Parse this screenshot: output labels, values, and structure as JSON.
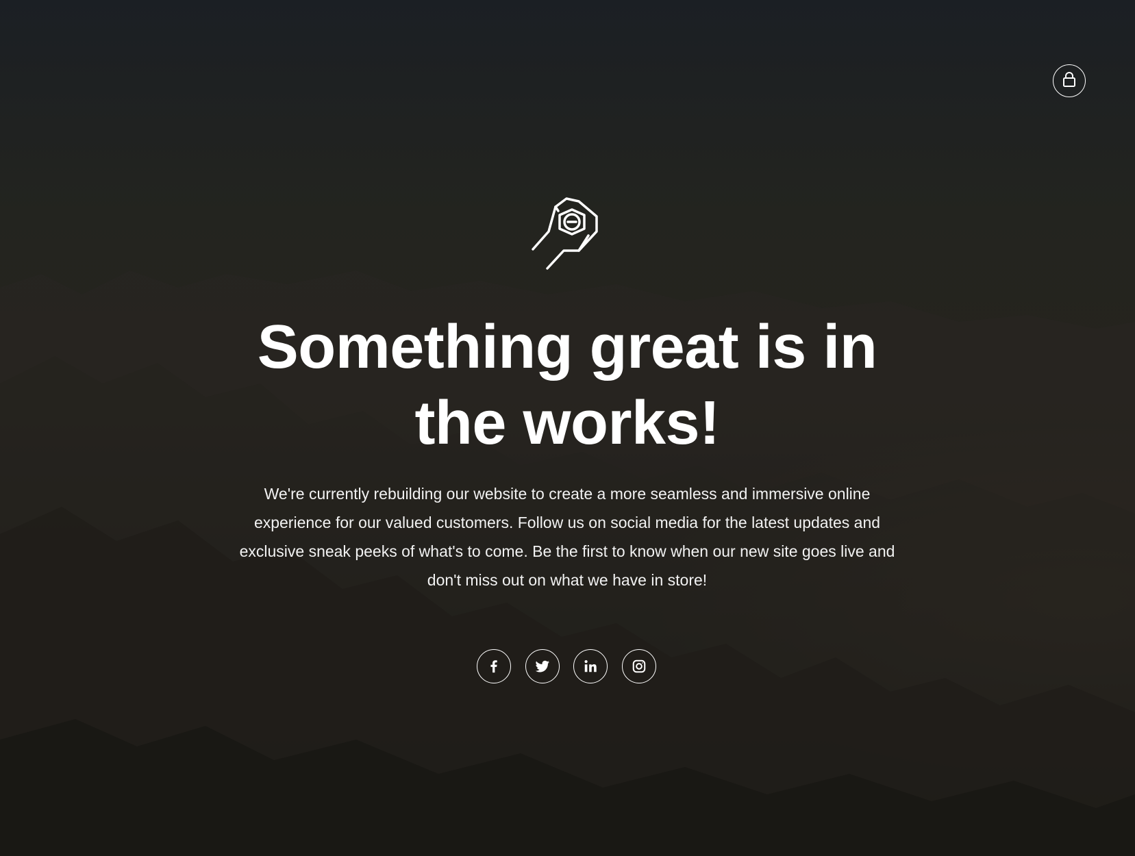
{
  "header": {
    "lock_icon": "lock-icon"
  },
  "logo": {
    "icon": "wrench-hand-icon"
  },
  "hero": {
    "headline": "Something great is in the works!",
    "description": "We're currently rebuilding our website to create a more seamless and immersive online experience for our valued customers. Follow us on social media for the latest updates and exclusive sneak peeks of what's to come. Be the first to know when our new site goes live and don't miss out on what we have in store!"
  },
  "social": {
    "items": [
      {
        "icon": "facebook-icon"
      },
      {
        "icon": "twitter-icon"
      },
      {
        "icon": "linkedin-icon"
      },
      {
        "icon": "instagram-icon"
      }
    ]
  },
  "colors": {
    "text": "#ffffff",
    "background_top": "#1b1f24",
    "background_bottom": "#141311"
  }
}
